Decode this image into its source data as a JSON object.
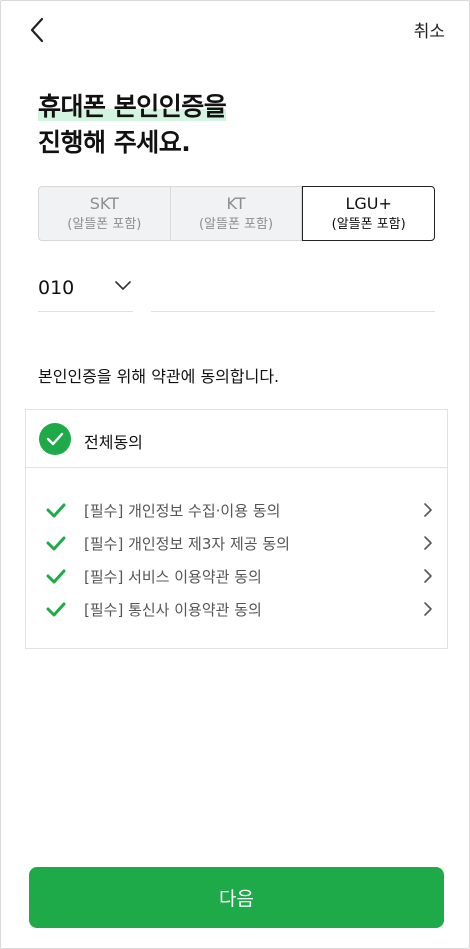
{
  "header": {
    "cancel_label": "취소"
  },
  "title": {
    "line1": "휴대폰 본인인증을",
    "line2": "진행해 주세요."
  },
  "carriers": [
    {
      "name": "SKT",
      "sub": "(알뜰폰 포함)",
      "selected": false
    },
    {
      "name": "KT",
      "sub": "(알뜰폰 포함)",
      "selected": false
    },
    {
      "name": "LGU+",
      "sub": "(알뜰폰 포함)",
      "selected": true
    }
  ],
  "phone": {
    "prefix": "010",
    "number": "",
    "placeholder": ""
  },
  "consent": {
    "guide": "본인인증을 위해 약관에 동의합니다.",
    "all_label": "전체동의",
    "items": [
      {
        "label": "[필수] 개인정보 수집·이용 동의"
      },
      {
        "label": "[필수] 개인정보 제3자 제공 동의"
      },
      {
        "label": "[필수] 서비스 이용약관 동의"
      },
      {
        "label": "[필수] 통신사 이용약관 동의"
      }
    ]
  },
  "next_button": {
    "label": "다음"
  },
  "colors": {
    "accent": "#1faa4a",
    "highlight": "#d3f5df"
  }
}
